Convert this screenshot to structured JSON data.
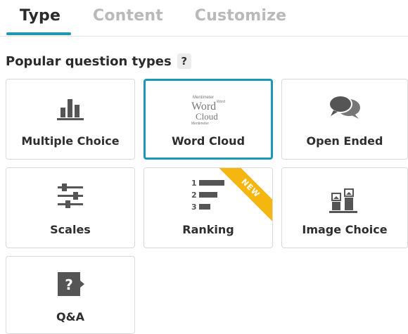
{
  "tabs": [
    {
      "label": "Type",
      "active": true
    },
    {
      "label": "Content",
      "active": false
    },
    {
      "label": "Customize",
      "active": false
    }
  ],
  "section": {
    "title": "Popular question types",
    "help_label": "?"
  },
  "cards": [
    {
      "label": "Multiple Choice",
      "icon": "bar-chart-icon",
      "selected": false
    },
    {
      "label": "Word Cloud",
      "icon": "word-cloud-icon",
      "selected": true,
      "icon_words": [
        "Mentimeter",
        "Word",
        "Cloud",
        "Word",
        "Mentimeter"
      ]
    },
    {
      "label": "Open Ended",
      "icon": "speech-bubbles-icon",
      "selected": false
    },
    {
      "label": "Scales",
      "icon": "sliders-icon",
      "selected": false
    },
    {
      "label": "Ranking",
      "icon": "ranking-icon",
      "selected": false,
      "badge": "NEW",
      "rank_numbers": [
        "1",
        "2",
        "3"
      ]
    },
    {
      "label": "Image Choice",
      "icon": "image-choice-icon",
      "selected": false
    },
    {
      "label": "Q&A",
      "icon": "question-bubble-icon",
      "selected": false,
      "icon_text": "?"
    }
  ],
  "colors": {
    "accent": "#1a98b5",
    "badge": "#f5b70f",
    "icon": "#555555",
    "tab_inactive": "#b9b9b9"
  }
}
